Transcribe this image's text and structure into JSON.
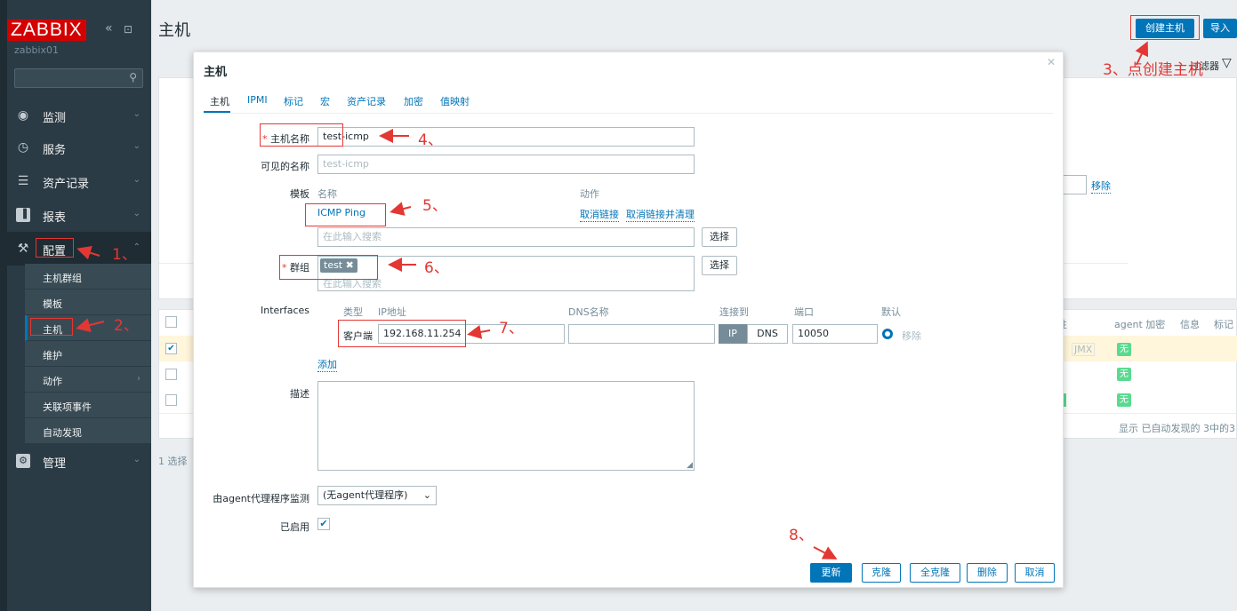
{
  "sidebar": {
    "logo": "ZABBIX",
    "collapse_icon": "«",
    "kiosk_icon": "⊡",
    "server": "zabbix01",
    "menu": [
      {
        "label": "监测",
        "icon": "eye-icon"
      },
      {
        "label": "服务",
        "icon": "clock-icon"
      },
      {
        "label": "资产记录",
        "icon": "list-icon"
      },
      {
        "label": "报表",
        "icon": "chart-icon"
      },
      {
        "label": "配置",
        "icon": "wrench-icon"
      },
      {
        "label": "管理",
        "icon": "gear-icon"
      }
    ],
    "submenu": [
      "主机群组",
      "模板",
      "主机",
      "维护",
      "动作",
      "关联项事件",
      "自动发现"
    ]
  },
  "page": {
    "title": "主机",
    "create_host": "创建主机",
    "import": "导入",
    "filter": "过滤器",
    "remove": "移除",
    "select_count": "1 选择",
    "col_availability": "性",
    "col_agent_enc": "agent 加密",
    "col_info": "信息",
    "col_tags": "标记",
    "jmx": "JMX",
    "none": "无",
    "footer": "显示 已自动发现的 3中的3"
  },
  "modal": {
    "title": "主机",
    "tabs": [
      "主机",
      "IPMI",
      "标记",
      "宏",
      "资产记录",
      "加密",
      "值映射"
    ],
    "host_name_label": "主机名称",
    "host_name": "test-icmp",
    "visible_name_label": "可见的名称",
    "visible_name_placeholder": "test-icmp",
    "templates_label": "模板",
    "templates_col_name": "名称",
    "templates_col_action": "动作",
    "template_name": "ICMP Ping",
    "unlink": "取消链接",
    "unlink_clear": "取消链接并清理",
    "search_placeholder": "在此输入搜索",
    "select": "选择",
    "groups_label": "群组",
    "group_tag": "test",
    "interfaces_label": "Interfaces",
    "if_type": "类型",
    "if_ip": "IP地址",
    "if_dns": "DNS名称",
    "if_connect": "连接到",
    "if_port": "端口",
    "if_default": "默认",
    "if_agent": "客户端",
    "if_ip_value": "192.168.11.254",
    "if_ip_btn": "IP",
    "if_dns_btn": "DNS",
    "if_port_value": "10050",
    "if_remove": "移除",
    "add": "添加",
    "description_label": "描述",
    "proxy_label": "由agent代理程序监测",
    "proxy_value": "(无agent代理程序)",
    "enabled_label": "已启用",
    "buttons": {
      "update": "更新",
      "clone": "克隆",
      "full_clone": "全克隆",
      "delete": "删除",
      "cancel": "取消"
    }
  },
  "annotations": [
    "1、",
    "2、",
    "3、点创建主机",
    "4、",
    "5、",
    "6、",
    "7、",
    "8、"
  ]
}
